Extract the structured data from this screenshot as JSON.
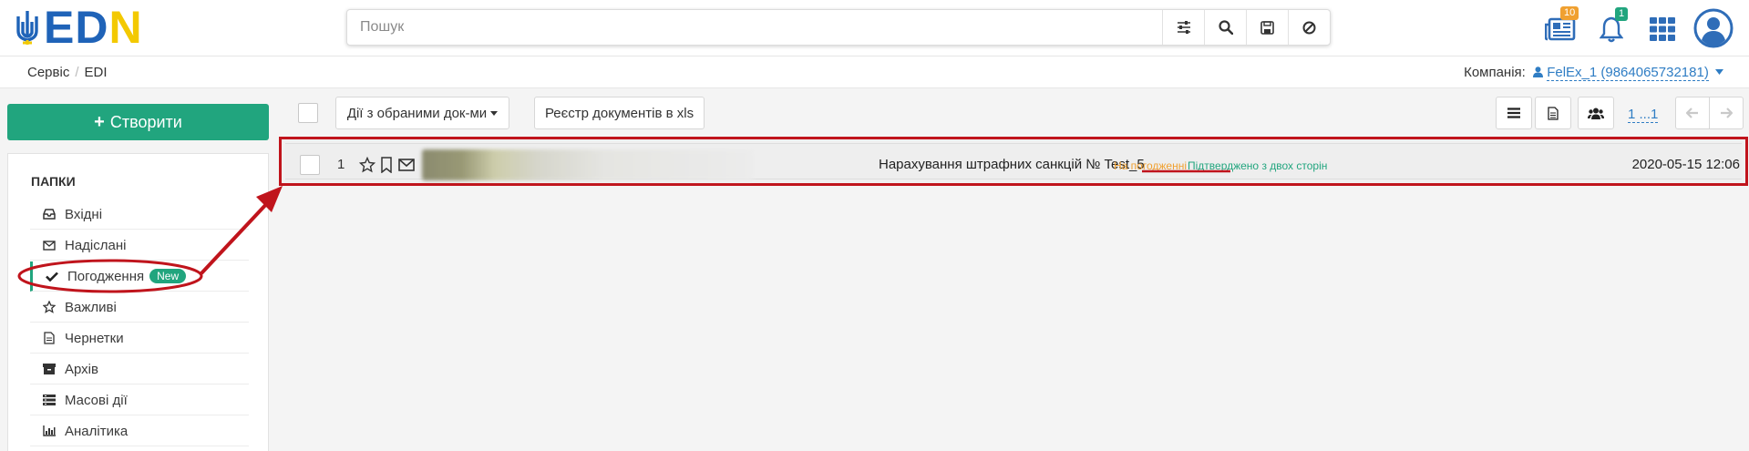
{
  "header": {
    "logo_text_ed": "ED",
    "logo_text_n": "N",
    "search_placeholder": "Пошук",
    "docs_badge": "10",
    "notif_badge": "1"
  },
  "breadcrumb": {
    "items": [
      "Сервіс",
      "EDI"
    ],
    "separator": "/"
  },
  "company": {
    "label": "Компанія:",
    "value": "FelEx_1 (9864065732181)"
  },
  "sidebar": {
    "create_label": "Створити",
    "create_plus": "+",
    "title": "ПАПКИ",
    "items": [
      {
        "label": "Вхідні",
        "icon": "inbox-icon"
      },
      {
        "label": "Надіслані",
        "icon": "envelope-icon"
      },
      {
        "label": "Погодження",
        "icon": "check-icon",
        "badge": "New"
      },
      {
        "label": "Важливі",
        "icon": "star-icon"
      },
      {
        "label": "Чернетки",
        "icon": "file-icon"
      },
      {
        "label": "Архів",
        "icon": "archive-icon"
      },
      {
        "label": "Масові дії",
        "icon": "bulk-icon"
      },
      {
        "label": "Аналітика",
        "icon": "chart-icon"
      }
    ]
  },
  "toolbar": {
    "bulk_actions_label": "Дії з обраними док-ми",
    "export_label": "Реєстр документів в xls",
    "pager_label": "1 ...1"
  },
  "document": {
    "index": "1",
    "title": "Нарахування штрафних санкцій № Test_5",
    "status_pending": "На погодженні",
    "status_confirmed": "Підтверджено з двох сторін",
    "date": "2020-05-15 12:06"
  },
  "colors": {
    "accent_green": "#21a57e",
    "brand_blue": "#1f63b8",
    "brand_yellow": "#f3c900",
    "annotation_red": "#c0141c",
    "status_orange": "#f0a030",
    "status_green": "#21a57e"
  }
}
